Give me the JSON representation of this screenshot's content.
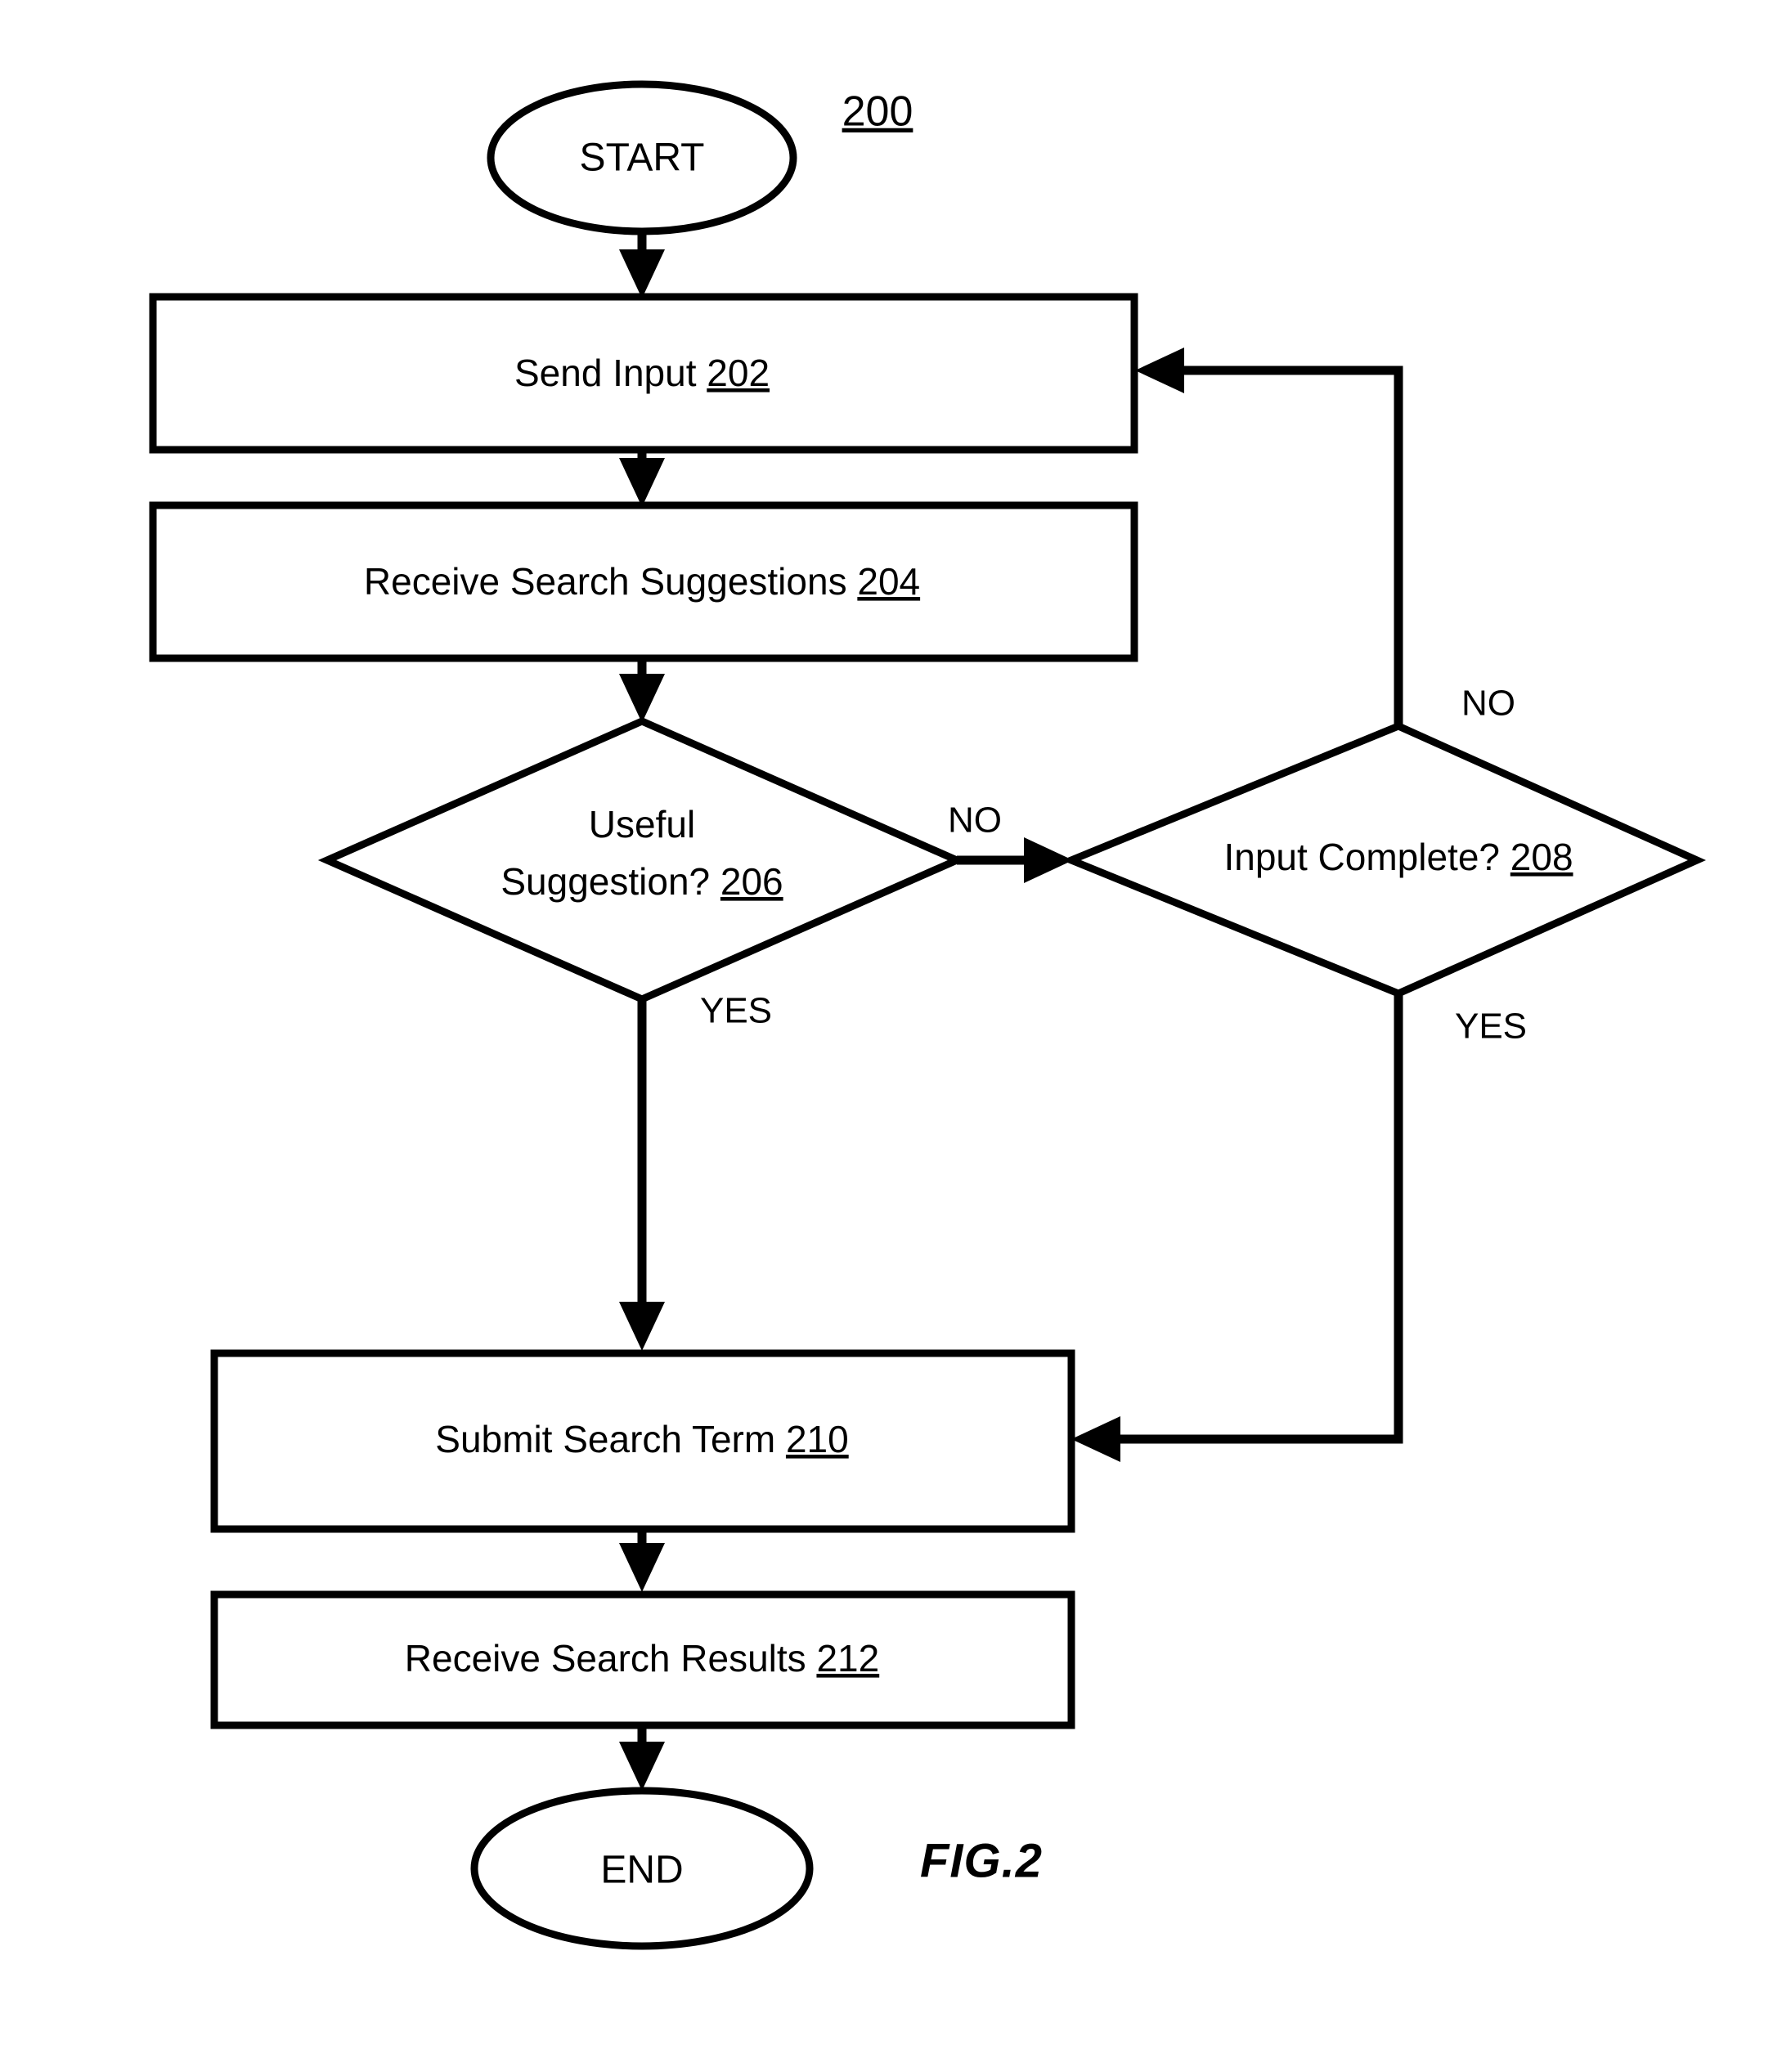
{
  "figure": {
    "caption": "FIG.2",
    "reference_number": "200"
  },
  "nodes": {
    "start": {
      "label": "START",
      "type": "terminator"
    },
    "send_input": {
      "label": "Send Input",
      "ref": "202",
      "type": "process"
    },
    "receive_suggestions": {
      "label": "Receive Search Suggestions",
      "ref": "204",
      "type": "process"
    },
    "useful_suggestion": {
      "label_line1": "Useful",
      "label_line2": "Suggestion?",
      "ref": "206",
      "type": "decision"
    },
    "input_complete": {
      "label": "Input Complete?",
      "ref": "208",
      "type": "decision"
    },
    "submit_search_term": {
      "label": "Submit Search Term",
      "ref": "210",
      "type": "process"
    },
    "receive_results": {
      "label": "Receive Search Results",
      "ref": "212",
      "type": "process"
    },
    "end": {
      "label": "END",
      "type": "terminator"
    }
  },
  "edges": {
    "useful_no": "NO",
    "useful_yes": "YES",
    "complete_no": "NO",
    "complete_yes": "YES"
  },
  "colors": {
    "stroke": "#000000",
    "fill": "#ffffff",
    "background": "#ffffff"
  }
}
